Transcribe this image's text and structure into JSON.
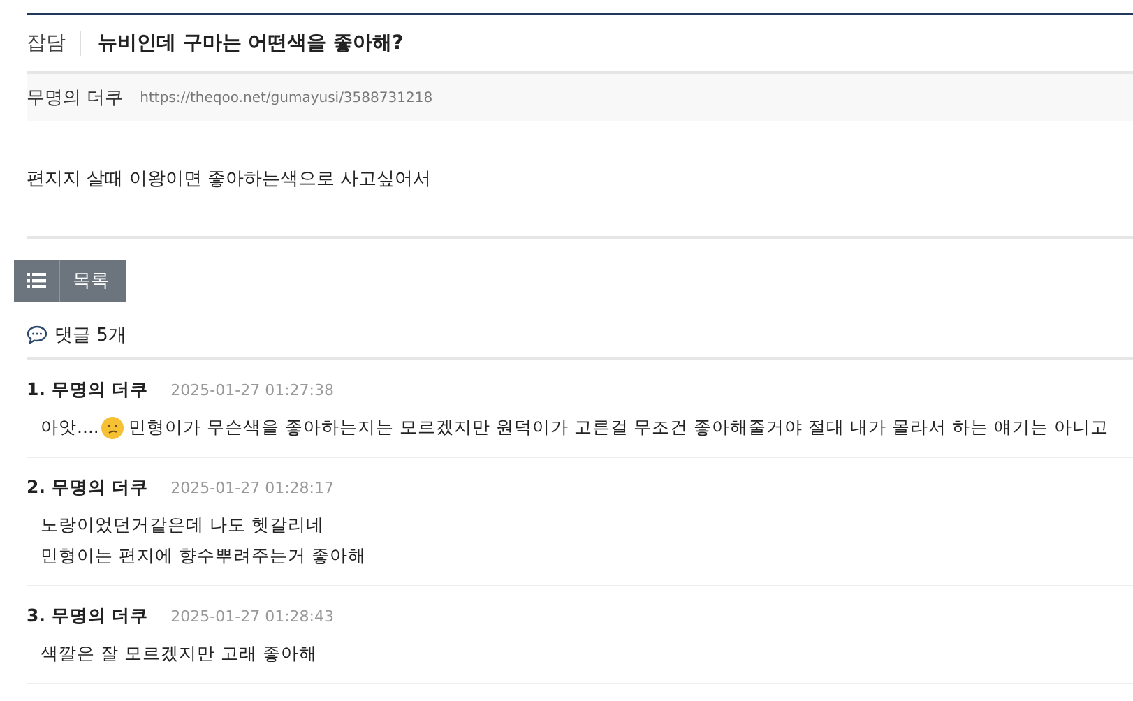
{
  "post": {
    "category": "잡담",
    "title": "뉴비인데 구마는 어떤색을 좋아해?",
    "author": "무명의 더쿠",
    "url": "https://theqoo.net/gumayusi/3588731218",
    "body": "편지지 살때 이왕이면 좋아하는색으로 사고싶어서"
  },
  "list_button": {
    "label": "목록"
  },
  "comments_header": {
    "label": "댓글 5개"
  },
  "comments": [
    {
      "number": "1.",
      "author": "무명의 더쿠",
      "time": "2025-01-27 01:27:38",
      "lines": [
        [
          {
            "kind": "text",
            "text": "아앗...."
          },
          {
            "kind": "emoji"
          },
          {
            "kind": "text",
            "text": "민형이가 무슨색을 좋아하는지는 모르겠지만 원덕이가 고른걸 무조건 좋아해줄거야 절대 내가 몰라서 하는 얘기는 아니고"
          }
        ]
      ]
    },
    {
      "number": "2.",
      "author": "무명의 더쿠",
      "time": "2025-01-27 01:28:17",
      "lines": [
        [
          {
            "kind": "text",
            "text": "노랑이었던거같은데 나도 헷갈리네"
          }
        ],
        [
          {
            "kind": "text",
            "text": "민형이는 편지에 향수뿌려주는거 좋아해"
          }
        ]
      ]
    },
    {
      "number": "3.",
      "author": "무명의 더쿠",
      "time": "2025-01-27 01:28:43",
      "lines": [
        [
          {
            "kind": "text",
            "text": "색깔은 잘 모르겠지만 고래 좋아해"
          }
        ]
      ]
    }
  ]
}
